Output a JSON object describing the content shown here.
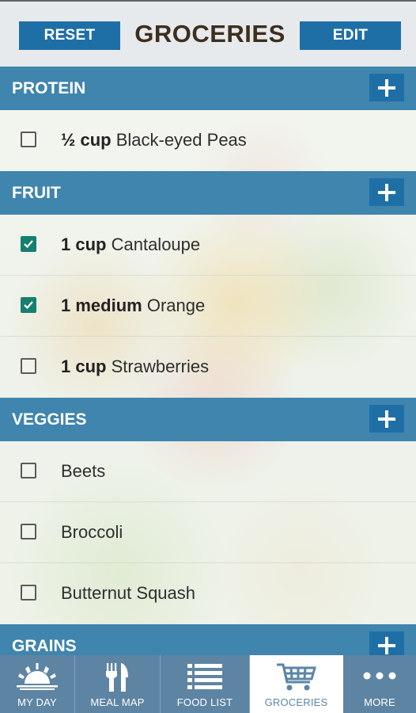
{
  "header": {
    "reset_label": "RESET",
    "title": "GROCERIES",
    "edit_label": "EDIT"
  },
  "sections": [
    {
      "title": "PROTEIN",
      "items": [
        {
          "qty": "½ cup",
          "name": "Black-eyed Peas",
          "checked": false
        }
      ]
    },
    {
      "title": "FRUIT",
      "items": [
        {
          "qty": "1 cup",
          "name": "Cantaloupe",
          "checked": true
        },
        {
          "qty": "1 medium",
          "name": "Orange",
          "checked": true
        },
        {
          "qty": "1 cup",
          "name": "Strawberries",
          "checked": false
        }
      ]
    },
    {
      "title": "VEGGIES",
      "items": [
        {
          "qty": "",
          "name": "Beets",
          "checked": false
        },
        {
          "qty": "",
          "name": "Broccoli",
          "checked": false
        },
        {
          "qty": "",
          "name": "Butternut Squash",
          "checked": false
        }
      ]
    },
    {
      "title": "GRAINS",
      "items": []
    }
  ],
  "tabs": [
    {
      "label": "MY DAY",
      "icon": "sunrise-icon",
      "active": false
    },
    {
      "label": "MEAL MAP",
      "icon": "fork-knife-icon",
      "active": false
    },
    {
      "label": "FOOD LIST",
      "icon": "list-icon",
      "active": false
    },
    {
      "label": "GROCERIES",
      "icon": "cart-icon",
      "active": true
    },
    {
      "label": "MORE",
      "icon": "more-icon",
      "active": false
    }
  ],
  "colors": {
    "header_button": "#1f6fa7",
    "section_bar": "#3f85ae",
    "checkbox_checked": "#167f6f",
    "tabbar": "#5d84a3",
    "title_text": "#3d2e1e"
  }
}
